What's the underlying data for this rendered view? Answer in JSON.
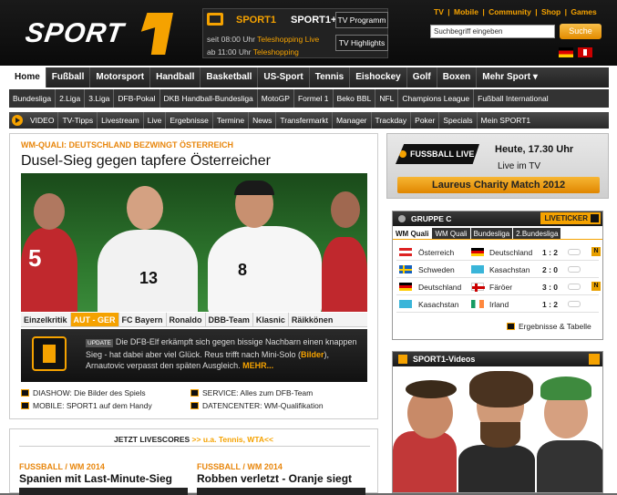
{
  "header": {
    "logo_text": "SPORT",
    "tv": {
      "tab1": "SPORT1",
      "tab2": "SPORT1+",
      "line1_time": "seit 08:00 Uhr",
      "line1_show": "Teleshopping Live",
      "line2_time": "ab 11:00 Uhr",
      "line2_show": "Teleshopping",
      "btn_program": "TV Programm",
      "btn_highlights": "TV Highlights"
    },
    "top_links": [
      "TV",
      "|",
      "Mobile",
      "|",
      "Community",
      "|",
      "Shop",
      "|",
      "Games"
    ],
    "search_placeholder": "Suchbegriff eingeben",
    "search_button": "Suche"
  },
  "main_nav": [
    "Home",
    "Fußball",
    "Motorsport",
    "Handball",
    "Basketball",
    "US-Sport",
    "Tennis",
    "Eishockey",
    "Golf",
    "Boxen",
    "Mehr Sport ▾"
  ],
  "sub_nav": [
    "Bundesliga",
    "2.Liga",
    "3.Liga",
    "DFB-Pokal",
    "DKB Handball-Bundesliga",
    "MotoGP",
    "Formel 1",
    "Beko BBL",
    "NFL",
    "Champions League",
    "Fußball International"
  ],
  "video_nav": [
    "VIDEO",
    "TV-Tipps",
    "Livestream",
    "Live",
    "Ergebnisse",
    "Termine",
    "News",
    "Transfermarkt",
    "Manager",
    "Trackday",
    "Poker",
    "Specials",
    "Mein SPORT1"
  ],
  "story": {
    "kicker": "WM-QUALI: DEUTSCHLAND BEZWINGT ÖSTERREICH",
    "headline": "Dusel-Sieg gegen tapfere Österreicher",
    "jersey_numbers": [
      "5",
      "13",
      "8"
    ],
    "tabs": [
      "Einzelkritik",
      "AUT - GER",
      "FC Bayern",
      "Ronaldo",
      "DBB-Team",
      "Klasnic",
      "Räikkönen"
    ],
    "update_badge": "UPDATE",
    "teaser_text": "Die DFB-Elf erkämpft sich gegen bissige Nachbarn einen knappen Sieg - hat dabei aber viel Glück. Reus trifft nach Mini-Solo (",
    "teaser_link1": "Bilder",
    "teaser_text2": "), Arnautovic verpasst den späten Ausgleich.",
    "teaser_more": "MEHR...",
    "links": [
      "DIASHOW: Die Bilder des Spiels",
      "SERVICE: Alles zum DFB-Team",
      "MOBILE: SPORT1 auf dem Handy",
      "DATENCENTER: WM-Qualifikation"
    ]
  },
  "livescores": {
    "title": "JETZT LIVESCORES",
    "extra": ">> u.a. Tennis, WTA<<",
    "items": [
      {
        "kicker": "FUSSBALL / WM 2014",
        "headline": "Spanien mit Last-Minute-Sieg"
      },
      {
        "kicker": "FUSSBALL / WM 2014",
        "headline": "Robben verletzt - Oranje siegt"
      }
    ]
  },
  "promo": {
    "badge": "FUSSBALL LIVE",
    "time": "Heute, 17.30 Uhr",
    "channel": "Live im TV",
    "title": "Laureus Charity Match 2012"
  },
  "group": {
    "title": "GRUPPE C",
    "liveticker": "LIVETICKER",
    "tabs": [
      "WM Quali",
      "WM Quali",
      "Bundesliga",
      "2.Bundesliga"
    ],
    "matches": [
      {
        "home": "Österreich",
        "away": "Deutschland",
        "score": "1 : 2",
        "badge": "N"
      },
      {
        "home": "Schweden",
        "away": "Kasachstan",
        "score": "2 : 0",
        "badge": ""
      },
      {
        "home": "Deutschland",
        "away": "Färöer",
        "score": "3 : 0",
        "badge": "N"
      },
      {
        "home": "Kasachstan",
        "away": "Irland",
        "score": "1 : 2",
        "badge": ""
      }
    ],
    "more": "Ergebnisse & Tabelle"
  },
  "videos": {
    "title": "SPORT1-Videos"
  },
  "colors": {
    "accent": "#f5a200",
    "dark": "#1a1a1a"
  }
}
